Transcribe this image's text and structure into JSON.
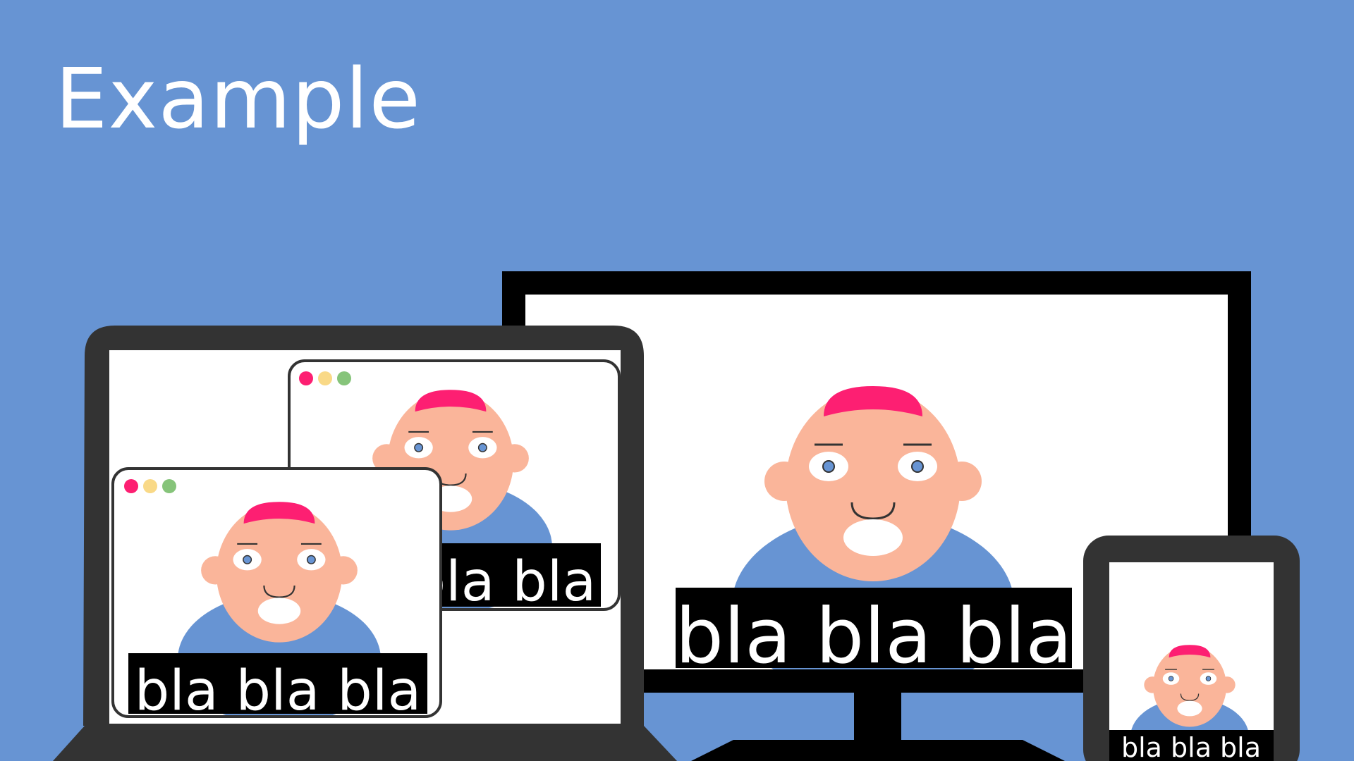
{
  "slide": {
    "title": "Example",
    "background": "#6794d3"
  },
  "caption": "bla bla bla",
  "colors": {
    "skin": "#fab59a",
    "hair": "#fd1f72",
    "shirt": "#6794d3",
    "eye_iris": "#6794d3",
    "device_frame": "#000000",
    "laptop_frame": "#333333",
    "screen": "#ffffff",
    "window_dots": [
      "#fd1f72",
      "#f9d987",
      "#86c47a"
    ]
  },
  "icons": [
    "monitor-icon",
    "laptop-icon",
    "phone-icon",
    "window-dots-icon"
  ]
}
